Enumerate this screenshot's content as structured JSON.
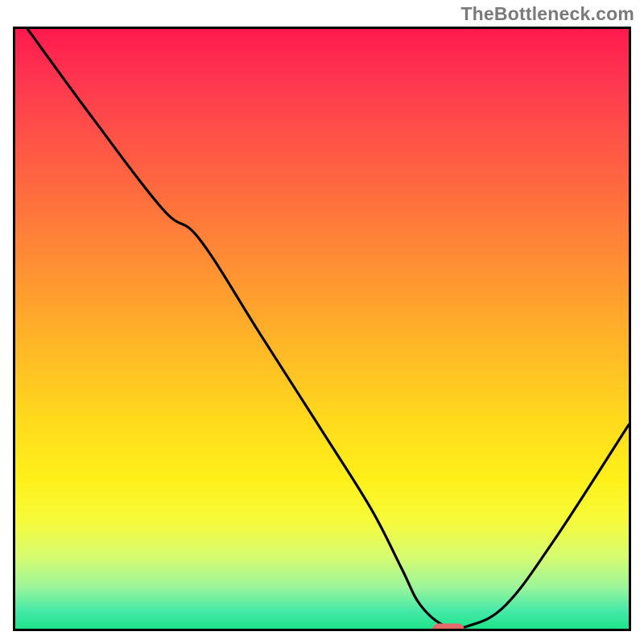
{
  "watermark": "TheBottleneck.com",
  "chart_data": {
    "type": "line",
    "title": "",
    "xlabel": "",
    "ylabel": "",
    "xlim": [
      0,
      100
    ],
    "ylim": [
      0,
      100
    ],
    "axes_visible": false,
    "grid": false,
    "background": "vertical red-to-green gradient",
    "series": [
      {
        "name": "curve",
        "x": [
          2,
          12,
          24,
          30,
          40,
          50,
          58,
          63,
          66,
          70,
          74,
          80,
          88,
          100
        ],
        "y": [
          100,
          86,
          70,
          65,
          49,
          33,
          20,
          10,
          4,
          0.5,
          0.5,
          4,
          15,
          34
        ]
      }
    ],
    "marker": {
      "x_percent": 70,
      "y_percent": 0.5,
      "color": "#e36a6a"
    },
    "gradient_stops": [
      {
        "pos": 0,
        "color": "#ff1a4d"
      },
      {
        "pos": 50,
        "color": "#ffba26"
      },
      {
        "pos": 80,
        "color": "#fff01a"
      },
      {
        "pos": 100,
        "color": "#1fe38a"
      }
    ]
  }
}
